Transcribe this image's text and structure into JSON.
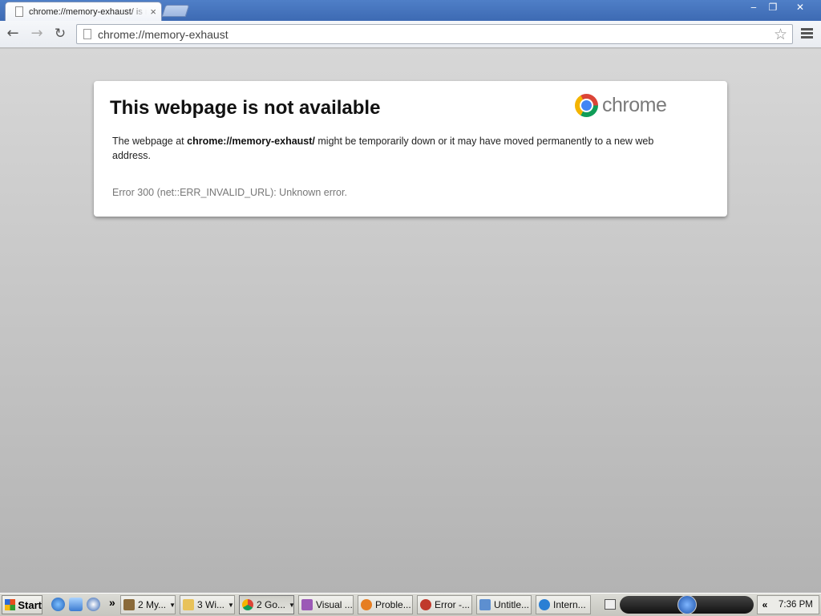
{
  "browser": {
    "tab_title": "chrome://memory-exhaust/ is not available",
    "tab_close": "×",
    "url": "chrome://memory-exhaust",
    "window_buttons": {
      "minimize": "‒",
      "maximize": "❐",
      "close": "✕"
    },
    "nav": {
      "back": "←",
      "forward": "→",
      "reload": "↻",
      "star": "☆"
    }
  },
  "error_page": {
    "title": "This webpage is not available",
    "desc_prefix": "The webpage at ",
    "desc_url": "chrome://memory-exhaust/",
    "desc_suffix": " might be temporarily down or it may have moved permanently to a new web address.",
    "error_code": "Error 300 (net::ERR_INVALID_URL): Unknown error.",
    "logo_text": "chrome"
  },
  "taskbar": {
    "start_label": "Start",
    "quicklaunch_more": "»",
    "tasks": [
      {
        "label": "2 My...",
        "color": "#8a6a3a",
        "grouped": true
      },
      {
        "label": "3 Wi...",
        "color": "#e8c25a",
        "grouped": true
      },
      {
        "label": "2 Go...",
        "color": "#4285f4",
        "grouped": true,
        "active": true
      },
      {
        "label": "Visual ...",
        "color": "#9b59b6",
        "grouped": false
      },
      {
        "label": "Proble...",
        "color": "#e67e22",
        "grouped": false
      },
      {
        "label": "Error -...",
        "color": "#c0392b",
        "grouped": false
      },
      {
        "label": "Untitle...",
        "color": "#5d8fd0",
        "grouped": false
      },
      {
        "label": "Intern...",
        "color": "#2a7fd4",
        "grouped": false
      }
    ],
    "tray_chevron": "«",
    "clock": "7:36 PM"
  }
}
